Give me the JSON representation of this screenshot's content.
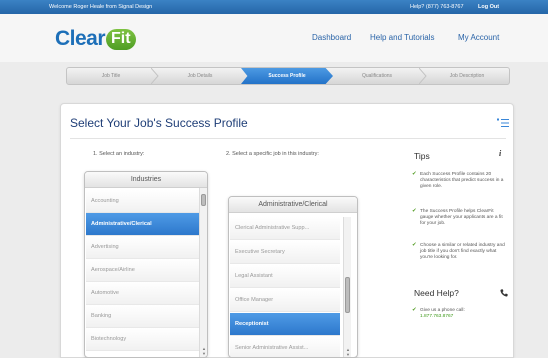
{
  "topbar": {
    "welcome": "Welcome Roger Heale from Signal Design",
    "help": "Help? (877) 763-8767",
    "logout": "Log Out"
  },
  "brand": {
    "logo_left": "Clear",
    "logo_right": "Fit"
  },
  "nav": [
    "Dashboard",
    "Help and Tutorials",
    "My Account"
  ],
  "steps": [
    "Job Title",
    "Job Details",
    "Success Profile",
    "Qualifications",
    "Job Description"
  ],
  "active_step": 2,
  "page": {
    "title": "Select Your Job's Success Profile"
  },
  "instructions": {
    "industry": "1. Select an industry:",
    "job": "2. Select a specific job in this industry:"
  },
  "industries": {
    "header": "Industries",
    "items": [
      "Accounting",
      "Administrative/Clerical",
      "Advertising",
      "Aerospace/Airline",
      "Automotive",
      "Banking",
      "Biotechnology"
    ],
    "selected": "Administrative/Clerical"
  },
  "jobs": {
    "header": "Administrative/Clerical",
    "items": [
      "Clerical Administrative Supp...",
      "Executive Secretary",
      "Legal Assistant",
      "Office Manager",
      "Receptionist",
      "Senior Administrative Assist..."
    ],
    "selected": "Receptionist"
  },
  "tips": {
    "title": "Tips",
    "items": [
      "Each Success Profile contains 20 characteristics that predict success in a given role.",
      "The Success Profile helps ClearFit gauge whether your applicants are a fit for your job.",
      "Choose a similar or related industry and job title if you don't find exactly what you're looking for."
    ]
  },
  "need_help": {
    "title": "Need Help?",
    "line1": "Give us a phone call:",
    "phone": "1.877.763.8767"
  },
  "colors": {
    "brand_blue": "#1d6fb8",
    "accent_green": "#5aa02c",
    "selected_blue": "#3a87d8"
  }
}
